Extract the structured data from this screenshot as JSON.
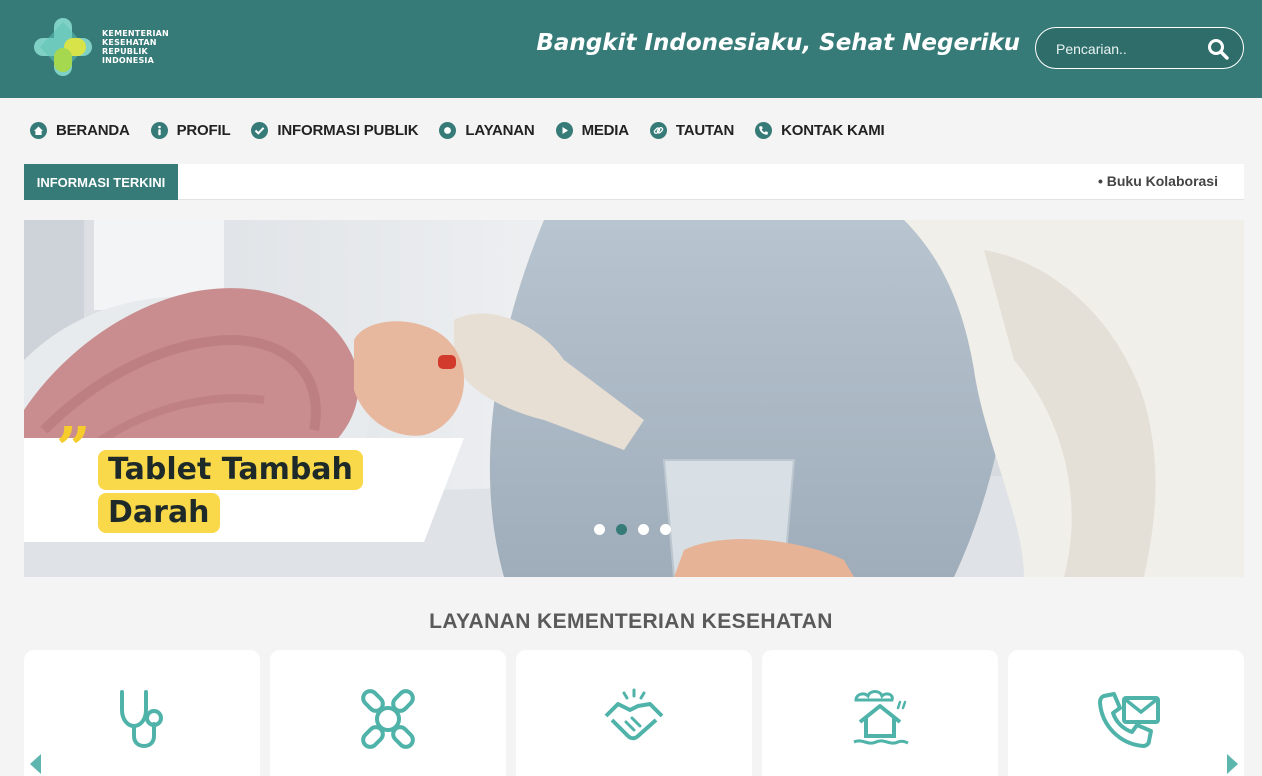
{
  "logo": {
    "lines": [
      "KEMENTERIAN",
      "KESEHATAN",
      "REPUBLIK",
      "INDONESIA"
    ]
  },
  "header": {
    "tagline": "Bangkit Indonesiaku, Sehat Negeriku",
    "search_placeholder": "Pencarian.."
  },
  "nav": [
    {
      "label": "BERANDA",
      "icon": "home-icon"
    },
    {
      "label": "PROFIL",
      "icon": "info-icon"
    },
    {
      "label": "INFORMASI PUBLIK",
      "icon": "check-icon"
    },
    {
      "label": "LAYANAN",
      "icon": "circle-icon"
    },
    {
      "label": "MEDIA",
      "icon": "play-icon"
    },
    {
      "label": "TAUTAN",
      "icon": "link-icon"
    },
    {
      "label": "KONTAK KAMI",
      "icon": "phone-icon"
    }
  ],
  "ticker": {
    "label": "INFORMASI TERKINI",
    "item": "• Buku Kolaborasi"
  },
  "hero": {
    "quote_mark": "”",
    "title_lines": [
      "Tablet Tambah",
      "Darah"
    ],
    "slide_count": 4,
    "active_slide": 2
  },
  "services": {
    "title": "LAYANAN KEMENTERIAN KESEHATAN",
    "icons": [
      "stethoscope-icon",
      "vaccine-icon",
      "handshake-icon",
      "disaster-house-icon",
      "contact-mail-icon"
    ]
  },
  "colors": {
    "primary": "#367b78",
    "accent": "#5cb6ae",
    "highlight": "#f9d84a"
  }
}
